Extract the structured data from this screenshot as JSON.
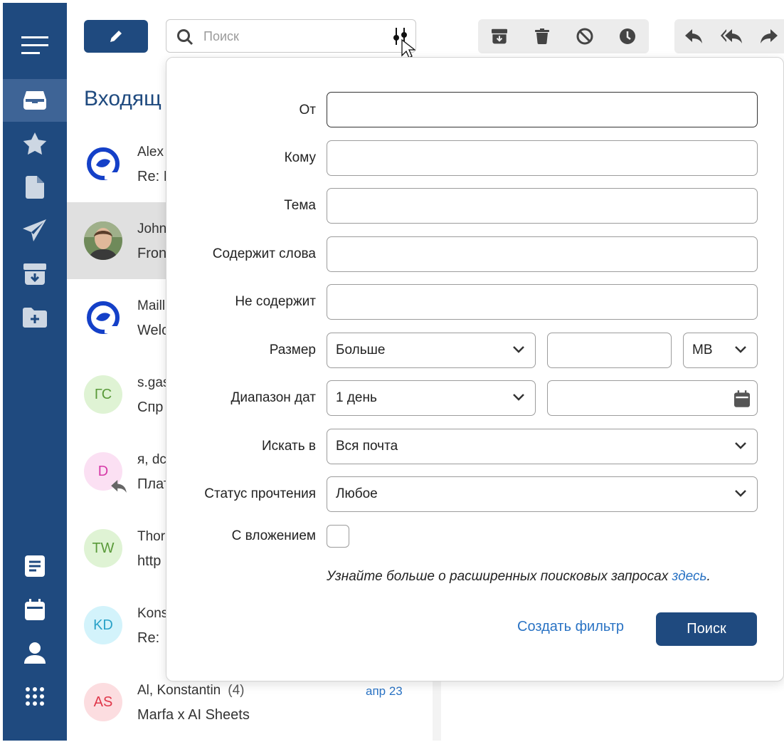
{
  "search": {
    "placeholder": "Поиск"
  },
  "mailbox": {
    "title": "Входящ"
  },
  "mail_list": [
    {
      "from": "Alex",
      "count": "",
      "subject": "Re: I",
      "date": "",
      "avatar_type": "logo",
      "avatar_text": "",
      "avatar_bg": "#ffffff",
      "avatar_fg": "#1440c8"
    },
    {
      "from": "John",
      "count": "",
      "subject": "Fron",
      "date": "",
      "avatar_type": "photo",
      "avatar_text": "",
      "avatar_bg": "#8a7a6a",
      "avatar_fg": "#ffffff"
    },
    {
      "from": "Maill",
      "count": "",
      "subject": "Welc",
      "date": "",
      "avatar_type": "logo",
      "avatar_text": "",
      "avatar_bg": "#ffffff",
      "avatar_fg": "#1440c8"
    },
    {
      "from": "s.gas",
      "count": "",
      "subject": "Спр",
      "date": "",
      "avatar_type": "initials",
      "avatar_text": "ГС",
      "avatar_bg": "#dff3d4",
      "avatar_fg": "#5a9a3a"
    },
    {
      "from": "я, dc",
      "count": "",
      "subject": "Плат",
      "date": "",
      "avatar_type": "initials",
      "avatar_text": "D",
      "avatar_bg": "#fbe0f3",
      "avatar_fg": "#d63aa8"
    },
    {
      "from": "Thor",
      "count": "",
      "subject": "http",
      "date": "",
      "avatar_type": "initials",
      "avatar_text": "TW",
      "avatar_bg": "#dff3d4",
      "avatar_fg": "#5a9a3a"
    },
    {
      "from": "Kons",
      "count": "",
      "subject": "Re:",
      "date": "",
      "avatar_type": "initials",
      "avatar_text": "KD",
      "avatar_bg": "#d3f3fb",
      "avatar_fg": "#2aa2c8"
    },
    {
      "from": "Al, Konstantin",
      "count": "(4)",
      "subject": "Marfa x AI Sheets",
      "date": "апр 23",
      "avatar_type": "initials",
      "avatar_text": "AS",
      "avatar_bg": "#fcdde0",
      "avatar_fg": "#e0374a"
    }
  ],
  "advanced_search": {
    "from_label": "От",
    "to_label": "Кому",
    "subject_label": "Тема",
    "contains_label": "Содержит слова",
    "not_contains_label": "Не содержит",
    "size_label": "Размер",
    "size_operator": "Больше",
    "size_unit": "MB",
    "date_range_label": "Диапазон дат",
    "date_range_value": "1 день",
    "search_in_label": "Искать в",
    "search_in_value": "Вся почта",
    "read_status_label": "Статус прочтения",
    "read_status_value": "Любое",
    "attachment_label": "С вложением",
    "hint_text": "Узнайте больше о расширенных поисковых запросах ",
    "hint_link": "здесь",
    "hint_end": ".",
    "create_filter_label": "Создать фильтр",
    "search_button_label": "Поиск"
  },
  "icons": {
    "rail": [
      "menu-icon",
      "inbox-icon",
      "star-icon",
      "draft-icon",
      "send-icon",
      "archive-icon",
      "new-folder-icon",
      "notes-icon",
      "calendar-icon",
      "contacts-icon",
      "apps-icon"
    ],
    "toolbar": [
      "compose-icon",
      "search-icon",
      "filter-options-icon",
      "archive-icon",
      "trash-icon",
      "spam-icon",
      "snooze-icon",
      "reply-icon",
      "reply-all-icon",
      "forward-icon"
    ]
  },
  "colors": {
    "brand": "#1f4a7f",
    "link": "#2a73c4",
    "rail_active": "#3e6496"
  }
}
